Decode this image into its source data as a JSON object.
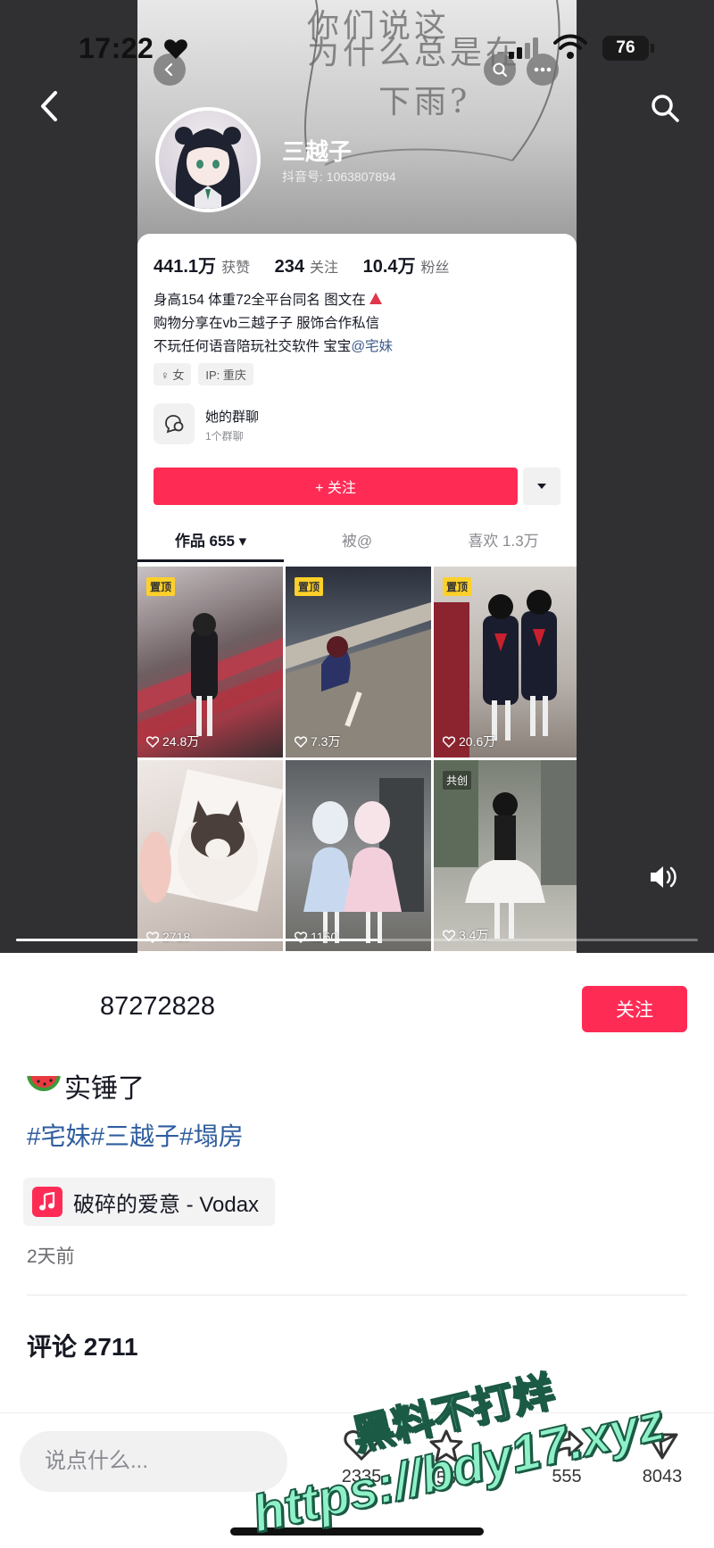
{
  "status_bar": {
    "time": "17:22",
    "battery": "76"
  },
  "embedded_profile": {
    "background_text": [
      "你们说这",
      "为什么总是在",
      "下雨?"
    ],
    "name": "三越子",
    "id": "抖音号: 1063807894",
    "stats": [
      {
        "value": "441.1万",
        "label": "获赞"
      },
      {
        "value": "234",
        "label": "关注"
      },
      {
        "value": "10.4万",
        "label": "粉丝"
      }
    ],
    "bio_lines": [
      "身高154 体重72全平台同名 图文在",
      "购物分享在vb三越子子 服饰合作私信",
      "不玩任何语音陪玩社交软件 宝宝"
    ],
    "bio_mention": "@宅妹",
    "tags": [
      "♀ 女",
      "IP: 重庆"
    ],
    "group_title": "她的群聊",
    "group_subtitle": "1个群聊",
    "follow_label": "+ 关注",
    "tabs": [
      "作品 655 ▾",
      "被@",
      "喜欢 1.3万"
    ],
    "pin_label": "置顶",
    "co_label": "共创",
    "posts": [
      {
        "likes": "24.8万",
        "pinned": true
      },
      {
        "likes": "7.3万",
        "pinned": true
      },
      {
        "likes": "20.6万",
        "pinned": true
      },
      {
        "likes": "2718",
        "pinned": false
      },
      {
        "likes": "1150",
        "pinned": false
      },
      {
        "likes": "3.4万",
        "pinned": false
      }
    ]
  },
  "video_progress": 0.53,
  "author": {
    "name": "87272828",
    "follow_label": "关注"
  },
  "caption": {
    "text": "实锤了",
    "hashtags": "#宅妹#三越子#塌房"
  },
  "music": {
    "title": "破碎的爱意 - Vodax"
  },
  "time_ago": "2天前",
  "comments": {
    "title": "评论 2711"
  },
  "bottom_bar": {
    "input_placeholder": "说点什么...",
    "likes": "2335",
    "favorites": "55",
    "shares": "555",
    "forwards": "8043"
  },
  "watermark": {
    "line1": "黑料不打烊",
    "line2": "https://bdy17.xyz"
  }
}
